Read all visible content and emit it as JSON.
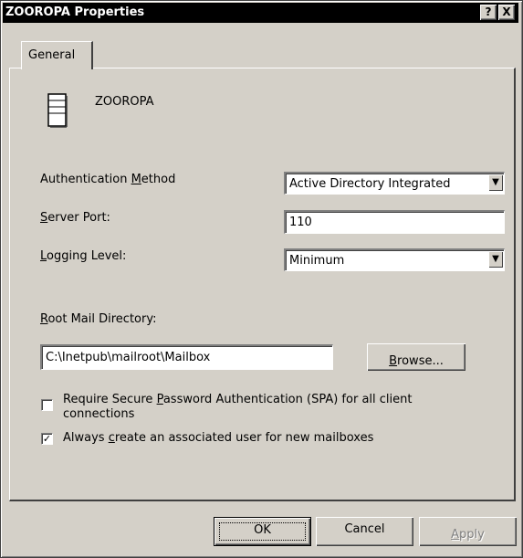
{
  "window": {
    "title": "ZOOROPA Properties",
    "help_button": "?",
    "close_button": "X"
  },
  "tabs": [
    {
      "label": "General"
    }
  ],
  "server": {
    "name": "ZOOROPA",
    "icon": "server-icon"
  },
  "auth": {
    "label_pre": "Authentication ",
    "label_key": "M",
    "label_post": "ethod",
    "value": "Active Directory Integrated"
  },
  "port": {
    "label_key": "S",
    "label_post": "erver Port:",
    "value": "110"
  },
  "logging": {
    "label_key": "L",
    "label_post": "ogging Level:",
    "value": "Minimum"
  },
  "root": {
    "label_key": "R",
    "label_post": "oot Mail Directory:",
    "value": "C:\\Inetpub\\mailroot\\Mailbox",
    "browse_key": "B",
    "browse_post": "rowse..."
  },
  "spa": {
    "line1_pre": "Require Secure ",
    "line1_key": "P",
    "line1_post": "assword Authentication (SPA) for all client",
    "line2": "connections",
    "checked": false
  },
  "associated_user": {
    "label_pre": "Always ",
    "label_key": "c",
    "label_post": "reate an associated user for new mailboxes",
    "checked": true,
    "mark": "✓"
  },
  "buttons": {
    "ok": "OK",
    "cancel": "Cancel",
    "apply_key": "A",
    "apply_post": "pply"
  }
}
